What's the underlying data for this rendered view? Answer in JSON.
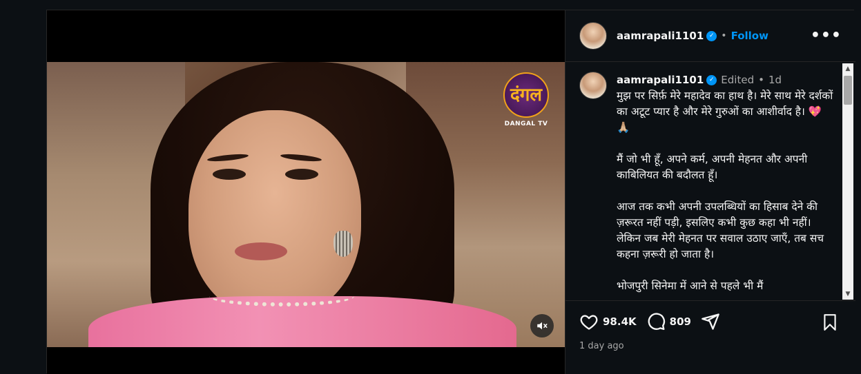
{
  "post": {
    "username": "aamrapali1101",
    "follow_label": "Follow",
    "more_label": "•••",
    "separator": "•",
    "edited_label": "Edited",
    "age_short": "1d",
    "time_label": "1 day ago"
  },
  "caption": {
    "paragraphs": [
      "मुझ पर सिर्फ़ मेरे महादेव का हाथ है। मेरे साथ मेरे दर्शकों का अटूट प्यार है और मेरे गुरुओं का आशीर्वाद है। 💖 🙏🏼",
      "मैं जो भी हूँ, अपने कर्म, अपनी मेहनत और अपनी काबिलियत की बदौलत हूँ।",
      "आज तक कभी अपनी उपलब्धियों का हिसाब देने की ज़रूरत नहीं पड़ी, इसलिए कभी कुछ कहा भी नहीं। लेकिन जब मेरी मेहनत पर सवाल उठाए जाएँ, तब सच कहना ज़रूरी हो जाता है।",
      "भोजपुरी सिनेमा में आने से पहले भी मैं"
    ]
  },
  "engagement": {
    "likes": "98.4K",
    "comments": "809"
  },
  "video": {
    "channel_logo_text": "दंगल",
    "channel_name": "DANGAL TV"
  },
  "colors": {
    "accent": "#0095f6",
    "background": "#0c1014",
    "text": "#f5f5f5",
    "muted": "#a8a8a8"
  },
  "icons": [
    "heart-icon",
    "comment-icon",
    "share-icon",
    "bookmark-icon",
    "mute-icon",
    "verified-icon",
    "more-icon"
  ]
}
